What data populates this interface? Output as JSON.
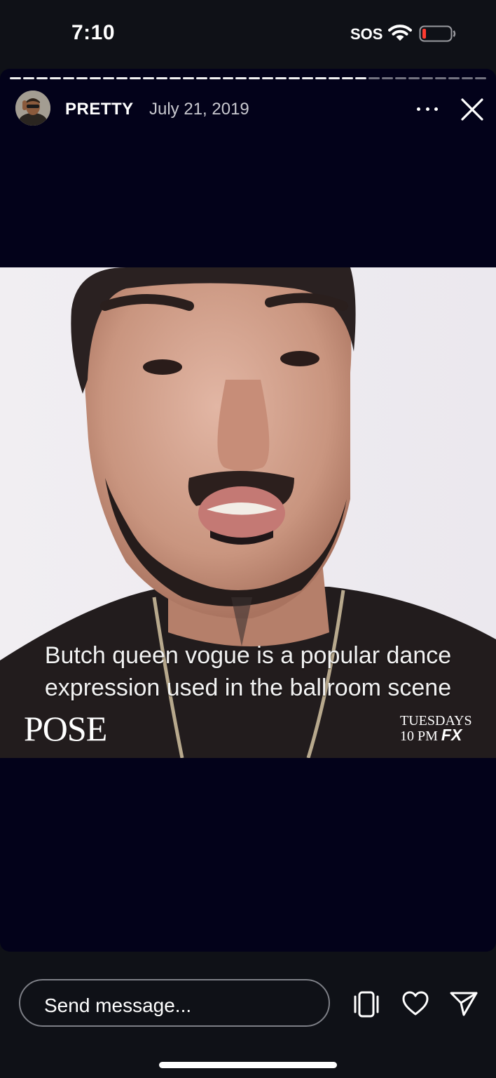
{
  "status_bar": {
    "time": "7:10",
    "sos": "SOS",
    "battery_level": 0.08,
    "battery_color": "#ff3b30"
  },
  "story": {
    "progress": {
      "segments_total": 36,
      "segments_completed": 27
    },
    "header": {
      "username": "PRETTY",
      "date": "July 21, 2019",
      "more_icon": "more-horizontal-icon",
      "close_icon": "close-icon"
    },
    "video": {
      "caption_line1": "Butch queen vogue is a popular dance",
      "caption_line2": "expression used in the ballroom scene",
      "logo": "POSE",
      "schedule_line1": "TUESDAYS",
      "schedule_line2": "10 PM",
      "network": "FX"
    }
  },
  "bottom_bar": {
    "message_placeholder": "Send message...",
    "icons": [
      "vibrate-phone-icon",
      "heart-icon",
      "send-icon"
    ]
  },
  "colors": {
    "background": "#0f1117",
    "story_background": "#03021a",
    "input_border": "#7d7f86"
  }
}
